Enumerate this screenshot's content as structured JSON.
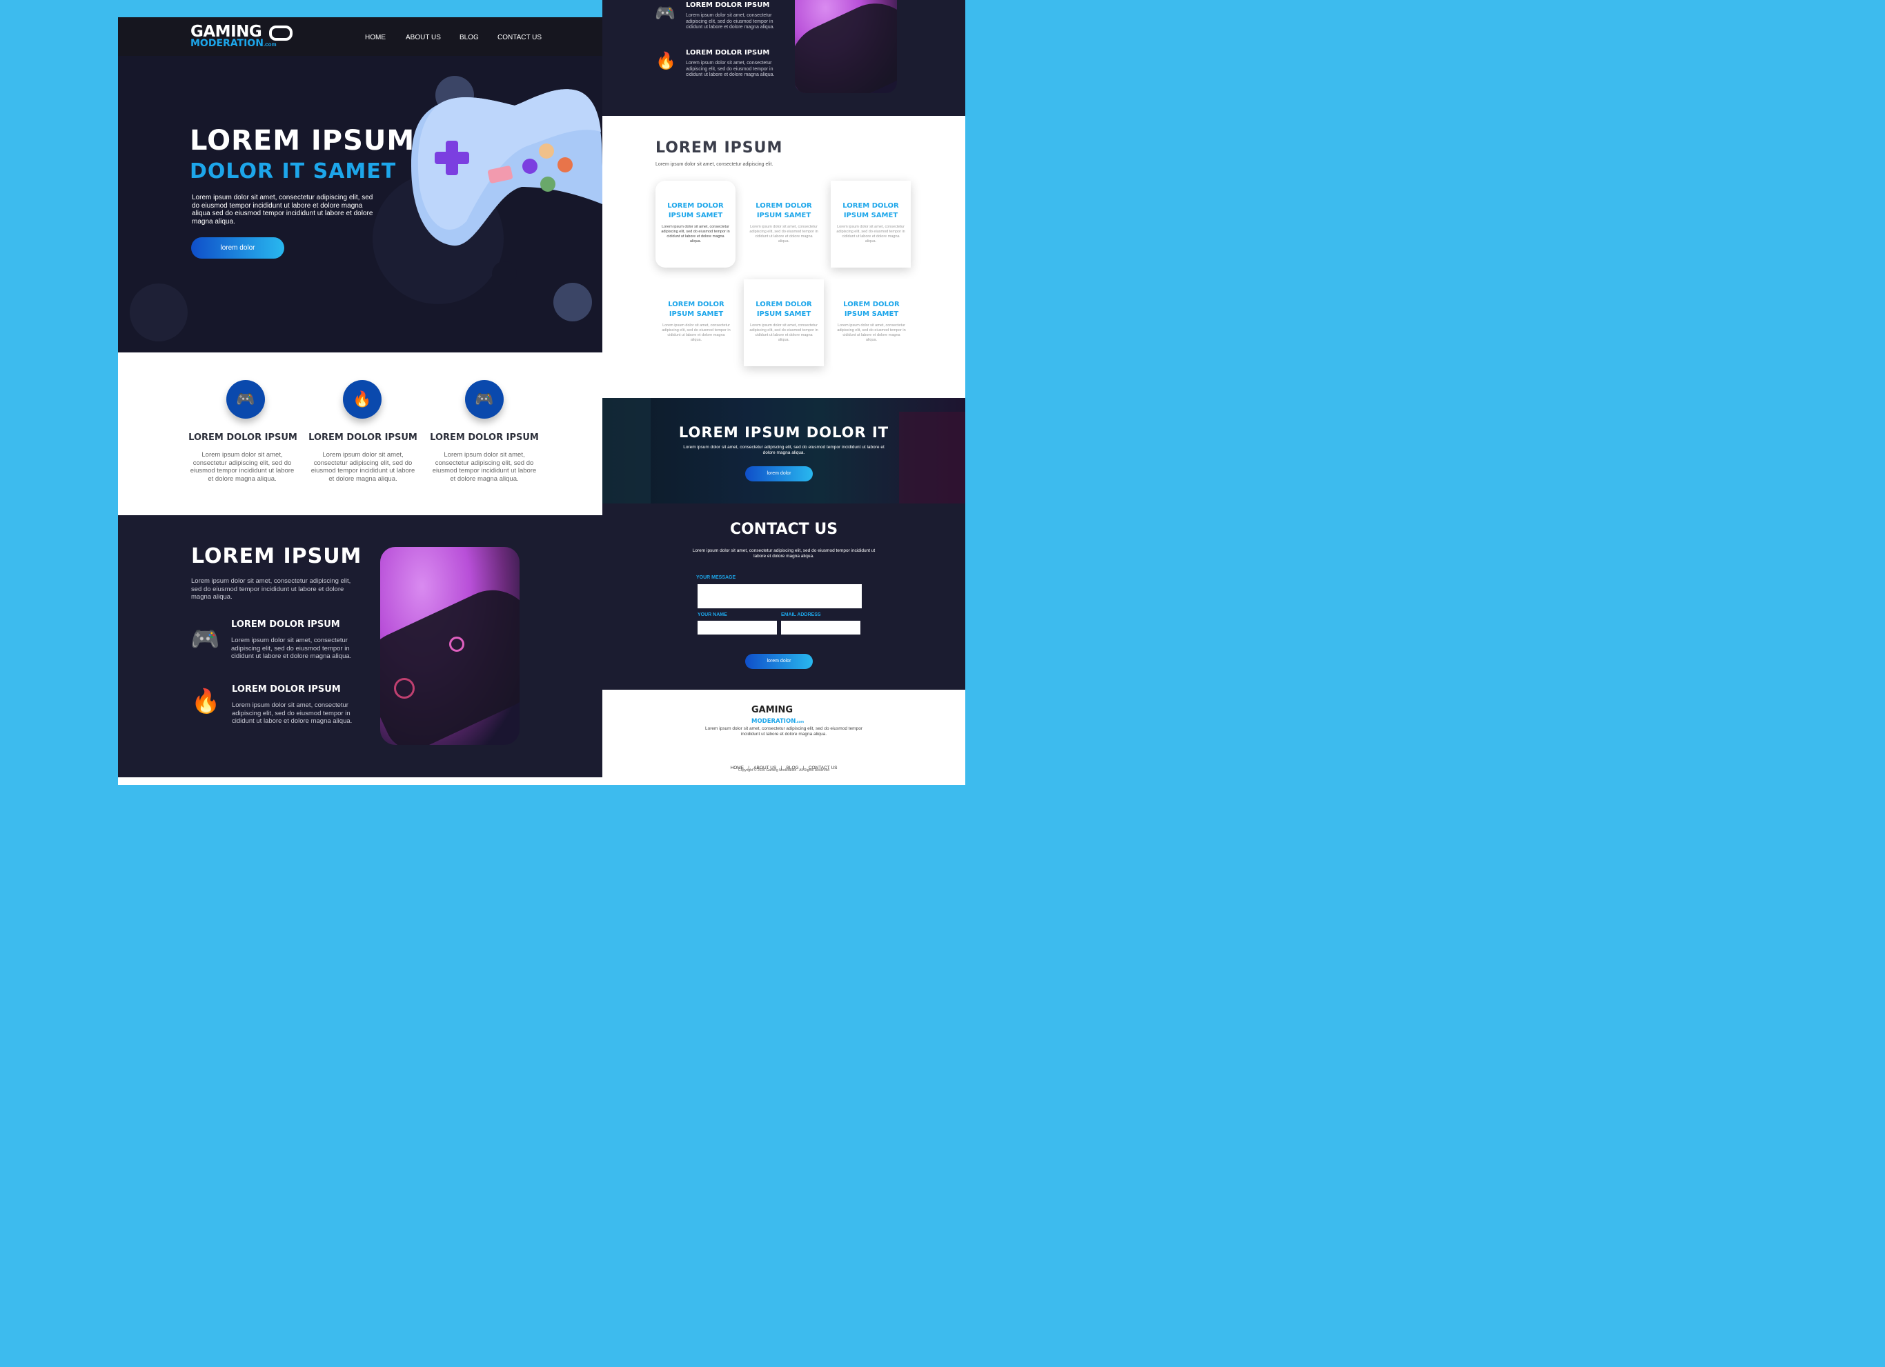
{
  "logo": {
    "line1": "GAMING",
    "line2": "MODERATION",
    "tld": ".com"
  },
  "nav": [
    {
      "label": "HOME"
    },
    {
      "label": "ABOUT US"
    },
    {
      "label": "BLOG"
    },
    {
      "label": "CONTACT US"
    }
  ],
  "hero": {
    "title": "LOREM IPSUM",
    "subtitle": "DOLOR IT SAMET",
    "text": "Lorem ipsum dolor sit amet, consectetur adipiscing elit, sed do eiusmod tempor incididunt ut labore et dolore magna aliqua sed do eiusmod tempor incididunt ut labore et dolore magna aliqua.",
    "button": "lorem dolor"
  },
  "features": [
    {
      "icon": "gamepad-icon",
      "title": "LOREM DOLOR IPSUM",
      "text": "Lorem ipsum dolor sit amet, consectetur adipiscing elit, sed do eiusmod tempor incididunt ut labore et dolore magna aliqua."
    },
    {
      "icon": "fire-icon",
      "title": "LOREM DOLOR IPSUM",
      "text": "Lorem ipsum dolor sit amet, consectetur adipiscing elit, sed do eiusmod tempor incididunt ut labore et dolore magna aliqua."
    },
    {
      "icon": "gamepad-icon",
      "title": "LOREM DOLOR IPSUM",
      "text": "Lorem ipsum dolor sit amet, consectetur adipiscing elit, sed do eiusmod tempor incididunt ut labore et dolore magna aliqua."
    }
  ],
  "about": {
    "title": "LOREM IPSUM",
    "text": "Lorem ipsum dolor sit amet, consectetur adipiscing elit, sed do eiusmod tempor incididunt ut labore et dolore magna aliqua.",
    "items": [
      {
        "icon": "gamepad-icon",
        "title": "LOREM DOLOR IPSUM",
        "text": "Lorem ipsum dolor sit amet, consectetur adipiscing elit, sed do eiusmod tempor in cididunt ut labore et dolore magna aliqua."
      },
      {
        "icon": "fire-icon",
        "title": "LOREM DOLOR IPSUM",
        "text": "Lorem ipsum dolor sit amet, consectetur adipiscing elit, sed do eiusmod tempor in cididunt ut labore et dolore magna aliqua."
      }
    ]
  },
  "right_top": {
    "items": [
      {
        "icon": "gamepad-icon",
        "title": "LOREM DOLOR IPSUM",
        "text": "Lorem ipsum dolor sit amet, consectetur adipiscing elit, sed do eiusmod tempor in cididunt ut labore et dolore magna aliqua."
      },
      {
        "icon": "fire-icon",
        "title": "LOREM DOLOR IPSUM",
        "text": "Lorem ipsum dolor sit amet, consectetur adipiscing elit, sed do eiusmod tempor in cididunt ut labore et dolore magna aliqua."
      }
    ]
  },
  "services": {
    "title": "LOREM IPSUM",
    "text": "Lorem ipsum dolor sit amet, consectetur adipiscing elit.",
    "card_title": "LOREM DOLOR IPSUM SAMET",
    "card_text": "Lorem ipsum dolor sit amet, consectetur adipiscing elit, sed do eiusmod tempor in cididunt ut labore et dolore magna aliqua."
  },
  "banner": {
    "title": "LOREM IPSUM DOLOR IT",
    "text": "Lorem ipsum dolor sit amet, consectetur adipiscing elit, sed do eiusmod tempor incididunt ut labore et dolore magna aliqua.",
    "button": "lorem dolor"
  },
  "contact": {
    "title": "CONTACT US",
    "text": "Lorem ipsum dolor sit amet, consectetur adipiscing elit, sed do eiusmod tempor incididunt ut labore et dolore magna aliqua.",
    "message_label": "YOUR MESSAGE",
    "name_label": "YOUR NAME",
    "email_label": "EMAIL ADDRESS",
    "button": "lorem dolor"
  },
  "footer": {
    "text": "Lorem ipsum dolor sit amet, consectetur adipiscing elit, sed do eiusmod tempor incididunt ut labore et dolore magna aliqua.",
    "links": [
      "HOME",
      "ABOUT US",
      "BLOG",
      "CONTACT US"
    ],
    "copyright": "Copyright © 2020 Gaming Moderation . All Rights Reserved"
  },
  "colors": {
    "accent": "#1da6ea",
    "dark": "#1b1c30",
    "icon_blue": "#0a49ad",
    "bg": "#3dbbee"
  }
}
